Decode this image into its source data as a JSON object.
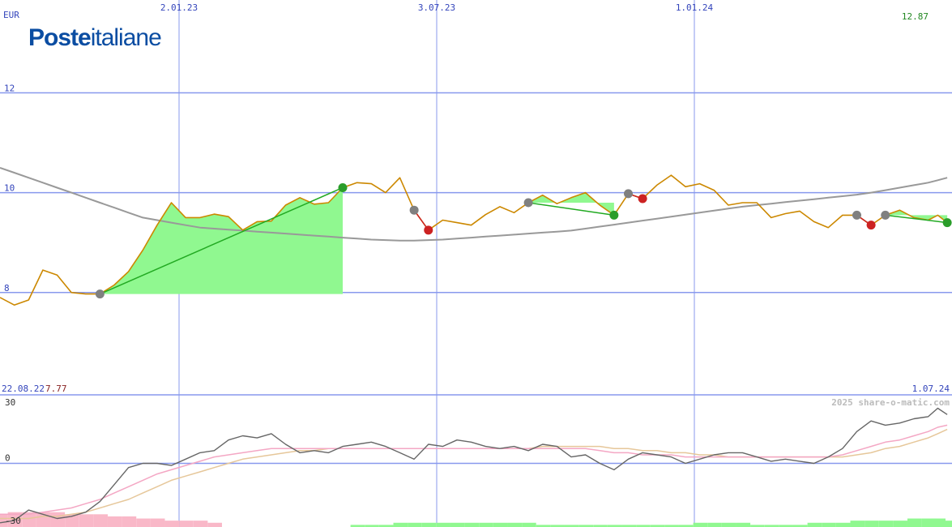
{
  "logo": {
    "bold": "Poste",
    "regular": "italiane"
  },
  "header": {
    "currency": "EUR",
    "last_price": "12.87"
  },
  "footer": {
    "start_date": "22.08.22",
    "start_price": "7.77",
    "end_date": "1.07.24",
    "watermark": "2025 share-o-matic.com"
  },
  "colors": {
    "grid": "#8899ee",
    "price": "#cc8800",
    "ma": "#999999",
    "trade_fill": "#90f890",
    "trade_line": "#22aa22",
    "buy_marker": "#808080",
    "win_marker": "#2a9d2a",
    "loss_marker": "#cc2222",
    "osc": "#666666",
    "osc_sig1": "#f4a7c4",
    "osc_sig2": "#e6c79a",
    "hist_neg": "#f9b8c8",
    "hist_pos": "#90f890"
  },
  "chart_data": [
    {
      "type": "line",
      "name": "price",
      "x_ticks": [
        "2.01.23",
        "3.07.23",
        "1.01.24"
      ],
      "y_ticks": [
        8,
        10,
        12
      ],
      "ylim": [
        5.95,
        13.6
      ],
      "x": [
        0,
        1.5,
        3,
        4.5,
        6,
        7.5,
        9,
        10.5,
        12,
        13.5,
        15,
        16.5,
        18,
        19.5,
        21,
        22.5,
        24,
        25.5,
        27,
        28.5,
        30,
        31.5,
        33,
        34.5,
        36,
        37.5,
        39,
        40.5,
        42,
        43.5,
        45,
        46.5,
        48,
        49.5,
        51,
        52.5,
        54,
        55.5,
        57,
        58.5,
        60,
        61.5,
        63,
        64.5,
        66,
        67.5,
        69,
        70.5,
        72,
        73.5,
        75,
        76.5,
        78,
        79.5,
        81,
        82.5,
        84,
        85.5,
        87,
        88.5,
        90,
        91.5,
        93,
        94.5,
        96,
        97.5,
        98.5,
        99.5
      ],
      "price": [
        7.9,
        7.75,
        7.85,
        8.45,
        8.35,
        8.0,
        7.97,
        7.97,
        8.15,
        8.42,
        8.85,
        9.35,
        9.8,
        9.5,
        9.5,
        9.57,
        9.52,
        9.25,
        9.42,
        9.43,
        9.75,
        9.9,
        9.77,
        9.8,
        10.1,
        10.2,
        10.18,
        10.0,
        10.3,
        9.65,
        9.25,
        9.45,
        9.4,
        9.35,
        9.56,
        9.72,
        9.6,
        9.8,
        9.95,
        9.78,
        9.9,
        10.0,
        9.75,
        9.55,
        9.98,
        9.88,
        10.15,
        10.35,
        10.12,
        10.18,
        10.05,
        9.75,
        9.8,
        9.8,
        9.5,
        9.58,
        9.63,
        9.42,
        9.3,
        9.55,
        9.55,
        9.35,
        9.55,
        9.65,
        9.5,
        9.45,
        9.55,
        9.4
      ],
      "ma": [
        10.5,
        10.4,
        10.3,
        10.2,
        10.1,
        10.0,
        9.9,
        9.8,
        9.7,
        9.6,
        9.5,
        9.45,
        9.4,
        9.35,
        9.3,
        9.28,
        9.26,
        9.24,
        9.22,
        9.2,
        9.18,
        9.16,
        9.14,
        9.12,
        9.1,
        9.08,
        9.06,
        9.05,
        9.04,
        9.04,
        9.05,
        9.06,
        9.08,
        9.1,
        9.12,
        9.14,
        9.16,
        9.18,
        9.2,
        9.22,
        9.24,
        9.28,
        9.32,
        9.36,
        9.4,
        9.44,
        9.48,
        9.52,
        9.56,
        9.6,
        9.64,
        9.68,
        9.72,
        9.75,
        9.78,
        9.81,
        9.84,
        9.87,
        9.9,
        9.93,
        9.96,
        10.0,
        10.05,
        10.1,
        10.15,
        10.2,
        10.25,
        10.3
      ]
    },
    {
      "type": "line",
      "name": "oscillator",
      "y_ticks": [
        -30,
        0,
        30
      ],
      "ylim": [
        -30,
        30
      ],
      "x": [
        0,
        1.5,
        3,
        4.5,
        6,
        7.5,
        9,
        10.5,
        12,
        13.5,
        15,
        16.5,
        18,
        19.5,
        21,
        22.5,
        24,
        25.5,
        27,
        28.5,
        30,
        31.5,
        33,
        34.5,
        36,
        37.5,
        39,
        40.5,
        42,
        43.5,
        45,
        46.5,
        48,
        49.5,
        51,
        52.5,
        54,
        55.5,
        57,
        58.5,
        60,
        61.5,
        63,
        64.5,
        66,
        67.5,
        69,
        70.5,
        72,
        73.5,
        75,
        76.5,
        78,
        79.5,
        81,
        82.5,
        84,
        85.5,
        87,
        88.5,
        90,
        91.5,
        93,
        94.5,
        96,
        97.5,
        98.5,
        99.5
      ],
      "osc": [
        -28,
        -27,
        -22,
        -24,
        -26,
        -25,
        -23,
        -18,
        -10,
        -2,
        0,
        0,
        -1,
        2,
        5,
        6,
        11,
        13,
        12,
        14,
        9,
        5,
        6,
        5,
        8,
        9,
        10,
        8,
        5,
        2,
        9,
        8,
        11,
        10,
        8,
        7,
        8,
        6,
        9,
        8,
        3,
        4,
        0,
        -3,
        2,
        5,
        4,
        3,
        0,
        2,
        4,
        5,
        5,
        3,
        1,
        2,
        1,
        0,
        3,
        7,
        15,
        20,
        18,
        19,
        21,
        22,
        26,
        23
      ],
      "signal_1": [
        -24,
        -24,
        -24,
        -23,
        -22,
        -21,
        -19,
        -17,
        -14,
        -11,
        -8,
        -5,
        -3,
        -1,
        1,
        3,
        4,
        5,
        6,
        7,
        7,
        7,
        7,
        7,
        7,
        7,
        7,
        7,
        7,
        7,
        7,
        7,
        7,
        7,
        7,
        7,
        7,
        7,
        7,
        7,
        7,
        7,
        6,
        5,
        5,
        4,
        4,
        4,
        3,
        3,
        3,
        3,
        3,
        3,
        3,
        3,
        3,
        3,
        3,
        4,
        6,
        8,
        10,
        11,
        13,
        15,
        17,
        18
      ],
      "signal_2": [
        -26,
        -26,
        -26,
        -25,
        -25,
        -24,
        -23,
        -21,
        -19,
        -17,
        -14,
        -11,
        -8,
        -6,
        -4,
        -2,
        0,
        2,
        3,
        4,
        5,
        6,
        6,
        7,
        7,
        7,
        7,
        7,
        7,
        7,
        7,
        7,
        7,
        7,
        7,
        7,
        7,
        7,
        8,
        8,
        8,
        8,
        8,
        7,
        7,
        6,
        6,
        5,
        5,
        4,
        4,
        3,
        3,
        3,
        3,
        3,
        3,
        3,
        3,
        3,
        4,
        5,
        7,
        8,
        10,
        12,
        14,
        16
      ],
      "hist_x": [
        0,
        1.5,
        3,
        4.5,
        6,
        7.5,
        9,
        10.5,
        12,
        13.5,
        15,
        16.5,
        18,
        19.5,
        21,
        22.5,
        37.5,
        39,
        40.5,
        42,
        43.5,
        45,
        46.5,
        48,
        49.5,
        51,
        52.5,
        54,
        55.5,
        57,
        58.5,
        60,
        61.5,
        63,
        64.5,
        66,
        67.5,
        69,
        70.5,
        72,
        73.5,
        75,
        76.5,
        78,
        79.5,
        81,
        82.5,
        84,
        85.5,
        87,
        88.5,
        90,
        91.5,
        93,
        94.5,
        96,
        97.5,
        98.5,
        99.5
      ],
      "hist": [
        -6,
        -7,
        -7,
        -7,
        -7,
        -6,
        -6,
        -6,
        -5,
        -5,
        -4,
        -4,
        -3,
        -3,
        -3,
        -2,
        1,
        1,
        1,
        2,
        2,
        2,
        2,
        2,
        2,
        2,
        2,
        2,
        2,
        1,
        1,
        1,
        1,
        1,
        1,
        1,
        1,
        1,
        1,
        1,
        2,
        2,
        2,
        2,
        1,
        1,
        1,
        1,
        2,
        2,
        2,
        3,
        3,
        3,
        3,
        4,
        4,
        4,
        3
      ]
    }
  ],
  "trades": [
    {
      "buy_i": 7,
      "sell_i": 24,
      "win": true
    },
    {
      "buy_i": 29,
      "sell_i": 30,
      "win": false
    },
    {
      "buy_i": 37,
      "sell_i": 43,
      "win": true
    },
    {
      "buy_i": 44,
      "sell_i": 45,
      "win": false
    },
    {
      "buy_i": 60,
      "sell_i": 61,
      "win": false
    },
    {
      "buy_i": 62,
      "sell_i": 67,
      "win": true
    }
  ]
}
